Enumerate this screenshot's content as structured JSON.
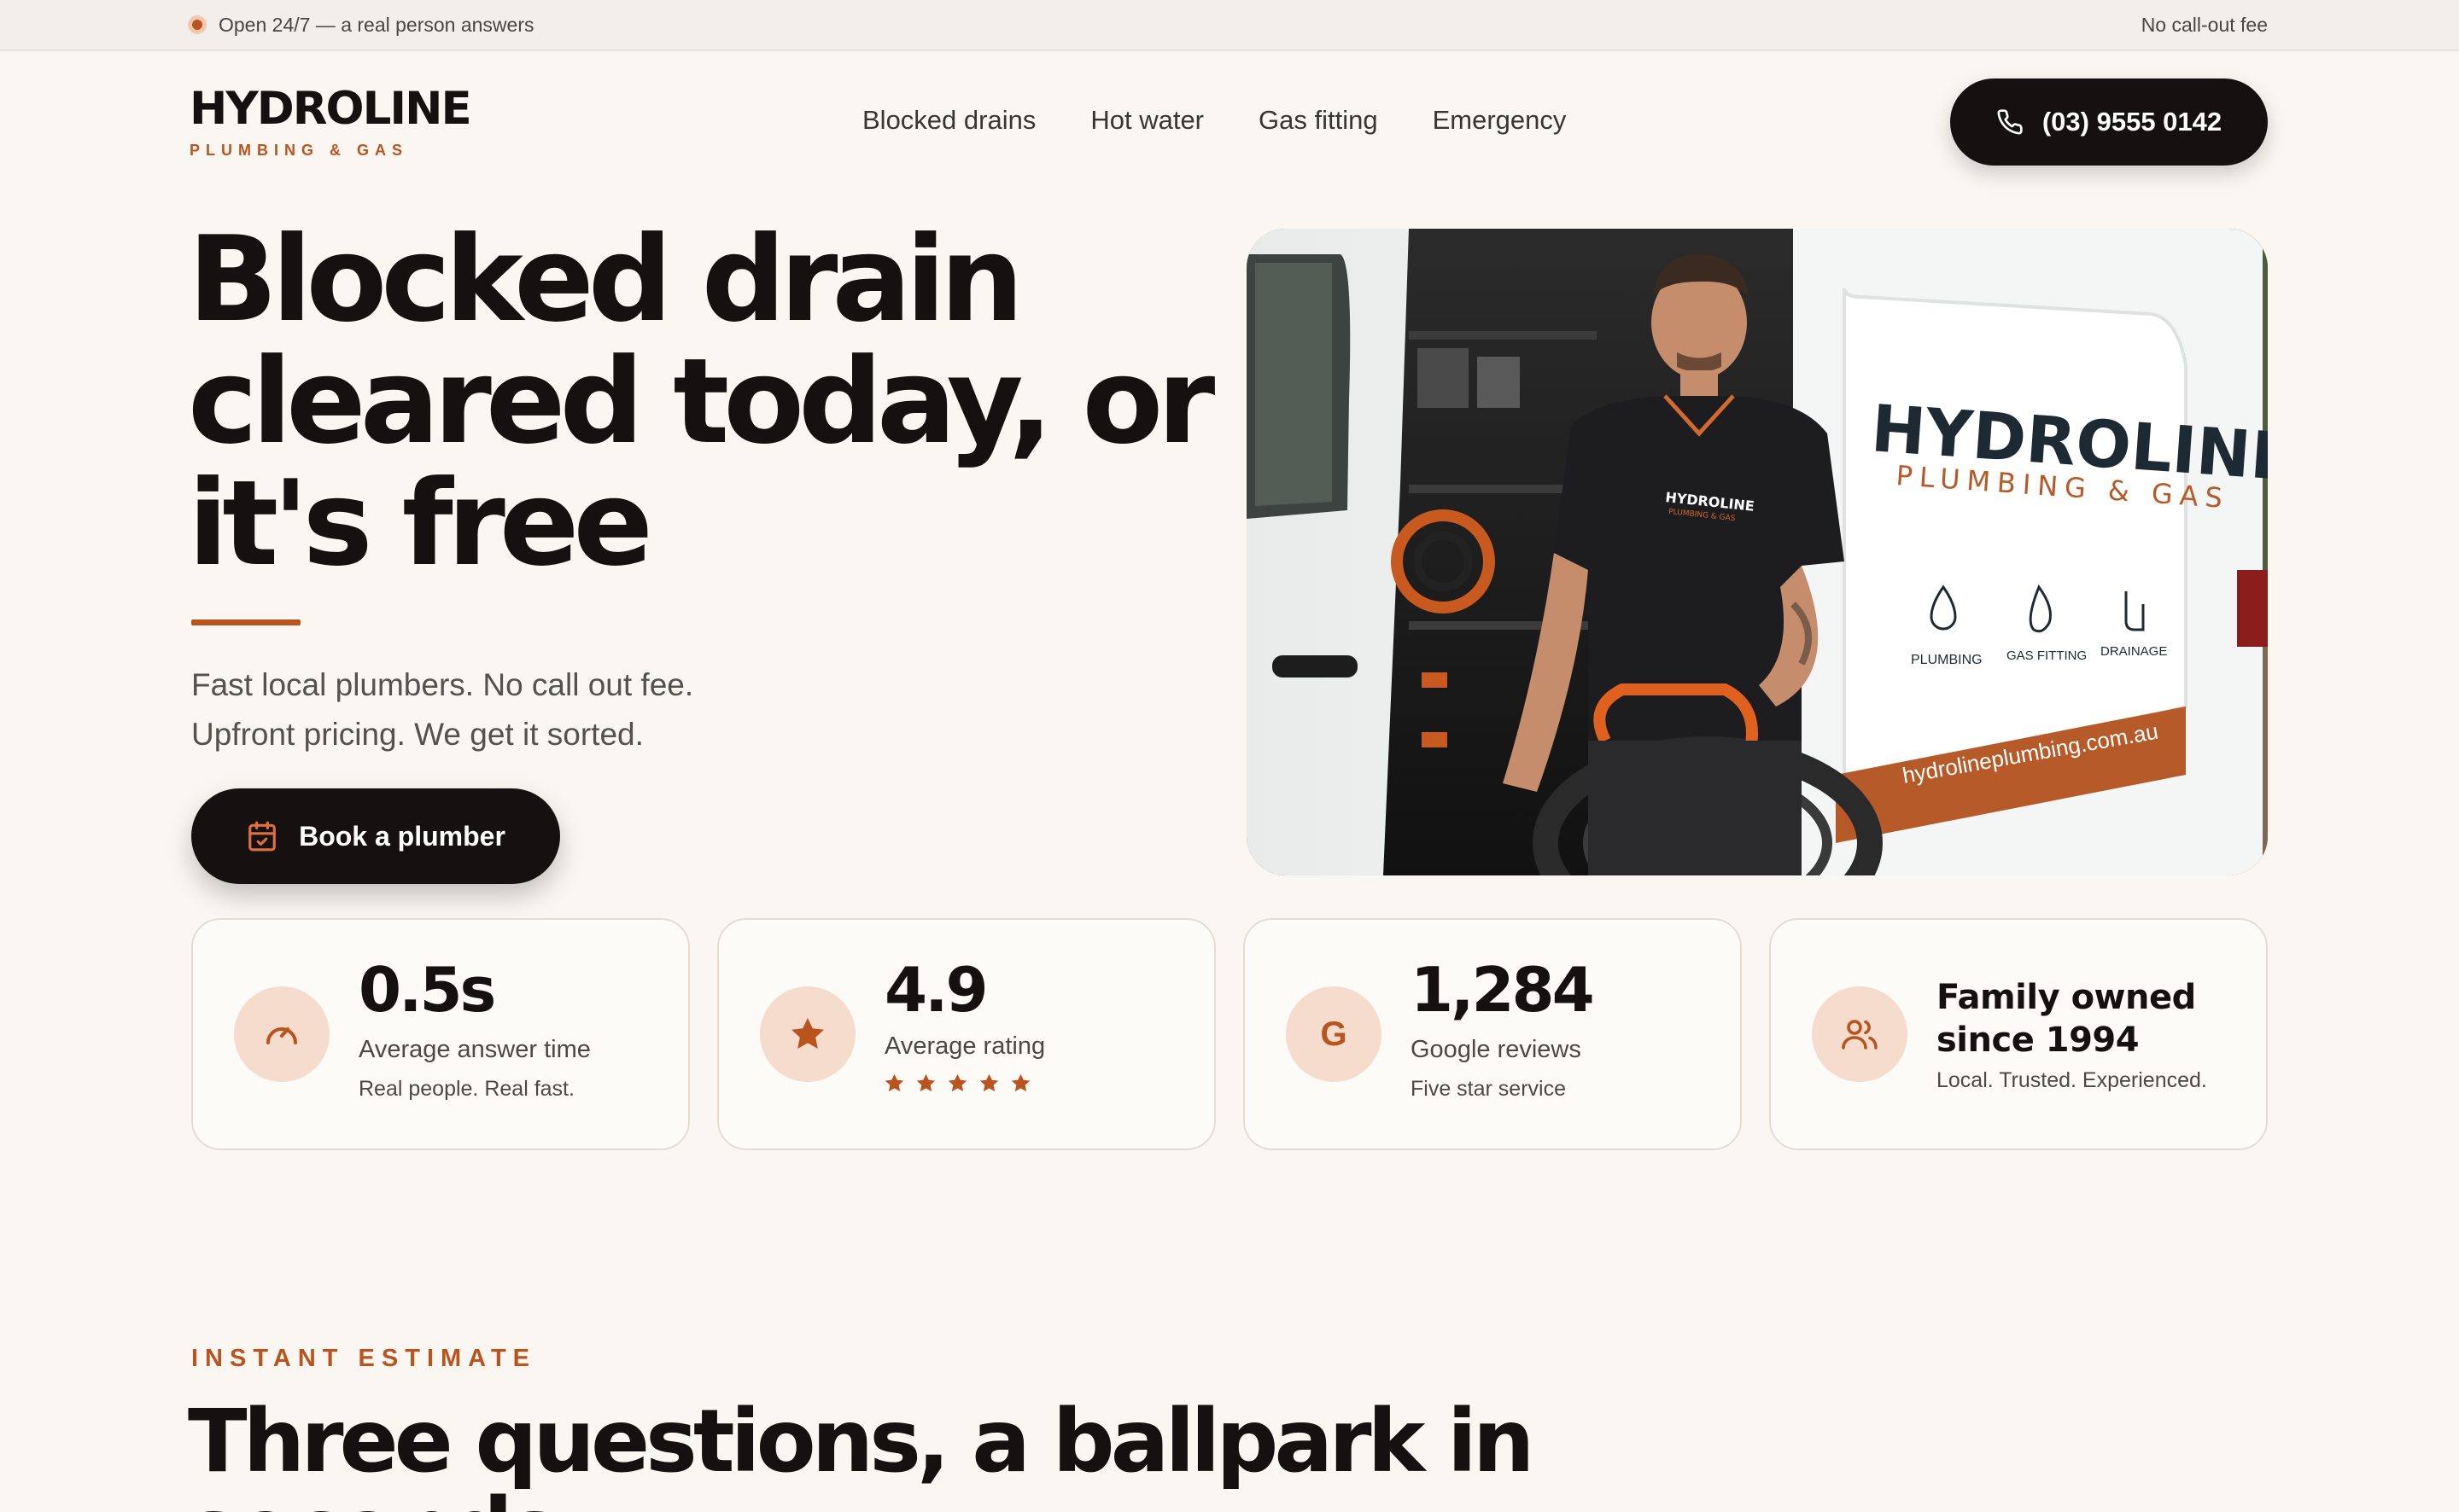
{
  "topbar": {
    "status_text": "Open 24/7 — a real person answers",
    "right_text": "No call-out fee"
  },
  "brand": {
    "name": "HYDROLINE",
    "tagline": "PLUMBING & GAS"
  },
  "nav": {
    "items": [
      {
        "label": "Blocked drains"
      },
      {
        "label": "Hot water"
      },
      {
        "label": "Gas fitting"
      },
      {
        "label": "Emergency"
      }
    ]
  },
  "header": {
    "phone_label": "(03) 9555 0142"
  },
  "hero": {
    "title": "Blocked drain cleared today, or it's free",
    "subtitle_line1": "Fast local plumbers. No call out fee.",
    "subtitle_line2": "Upfront pricing. We get it sorted.",
    "cta_label": "Book a plumber"
  },
  "hero_image": {
    "van_brand": "HYDROLINE",
    "van_tagline": "PLUMBING & GAS",
    "van_services": [
      "PLUMBING",
      "GAS FITTING",
      "DRAINAGE"
    ],
    "van_url": "hydrolineplumbing.com.au",
    "shirt_logo": "HYDROLINE",
    "shirt_tagline": "PLUMBING & GAS"
  },
  "stats": [
    {
      "icon": "speedometer-icon",
      "value": "0.5s",
      "label": "Average answer time",
      "note": "Real people. Real fast."
    },
    {
      "icon": "star-icon",
      "value": "4.9",
      "label": "Average rating",
      "stars": 5
    },
    {
      "icon": "google-icon",
      "value": "1,284",
      "label": "Google reviews",
      "note": "Five star service"
    },
    {
      "icon": "people-icon",
      "title": "Family owned since 1994",
      "note": "Local. Trusted. Experienced."
    }
  ],
  "estimate": {
    "eyebrow": "INSTANT ESTIMATE",
    "title": "Three questions, a ballpark in seconds"
  },
  "colors": {
    "accent": "#b9541f",
    "ink": "#141110",
    "background": "#faf7f3",
    "icon_bg": "#f5dccc"
  }
}
